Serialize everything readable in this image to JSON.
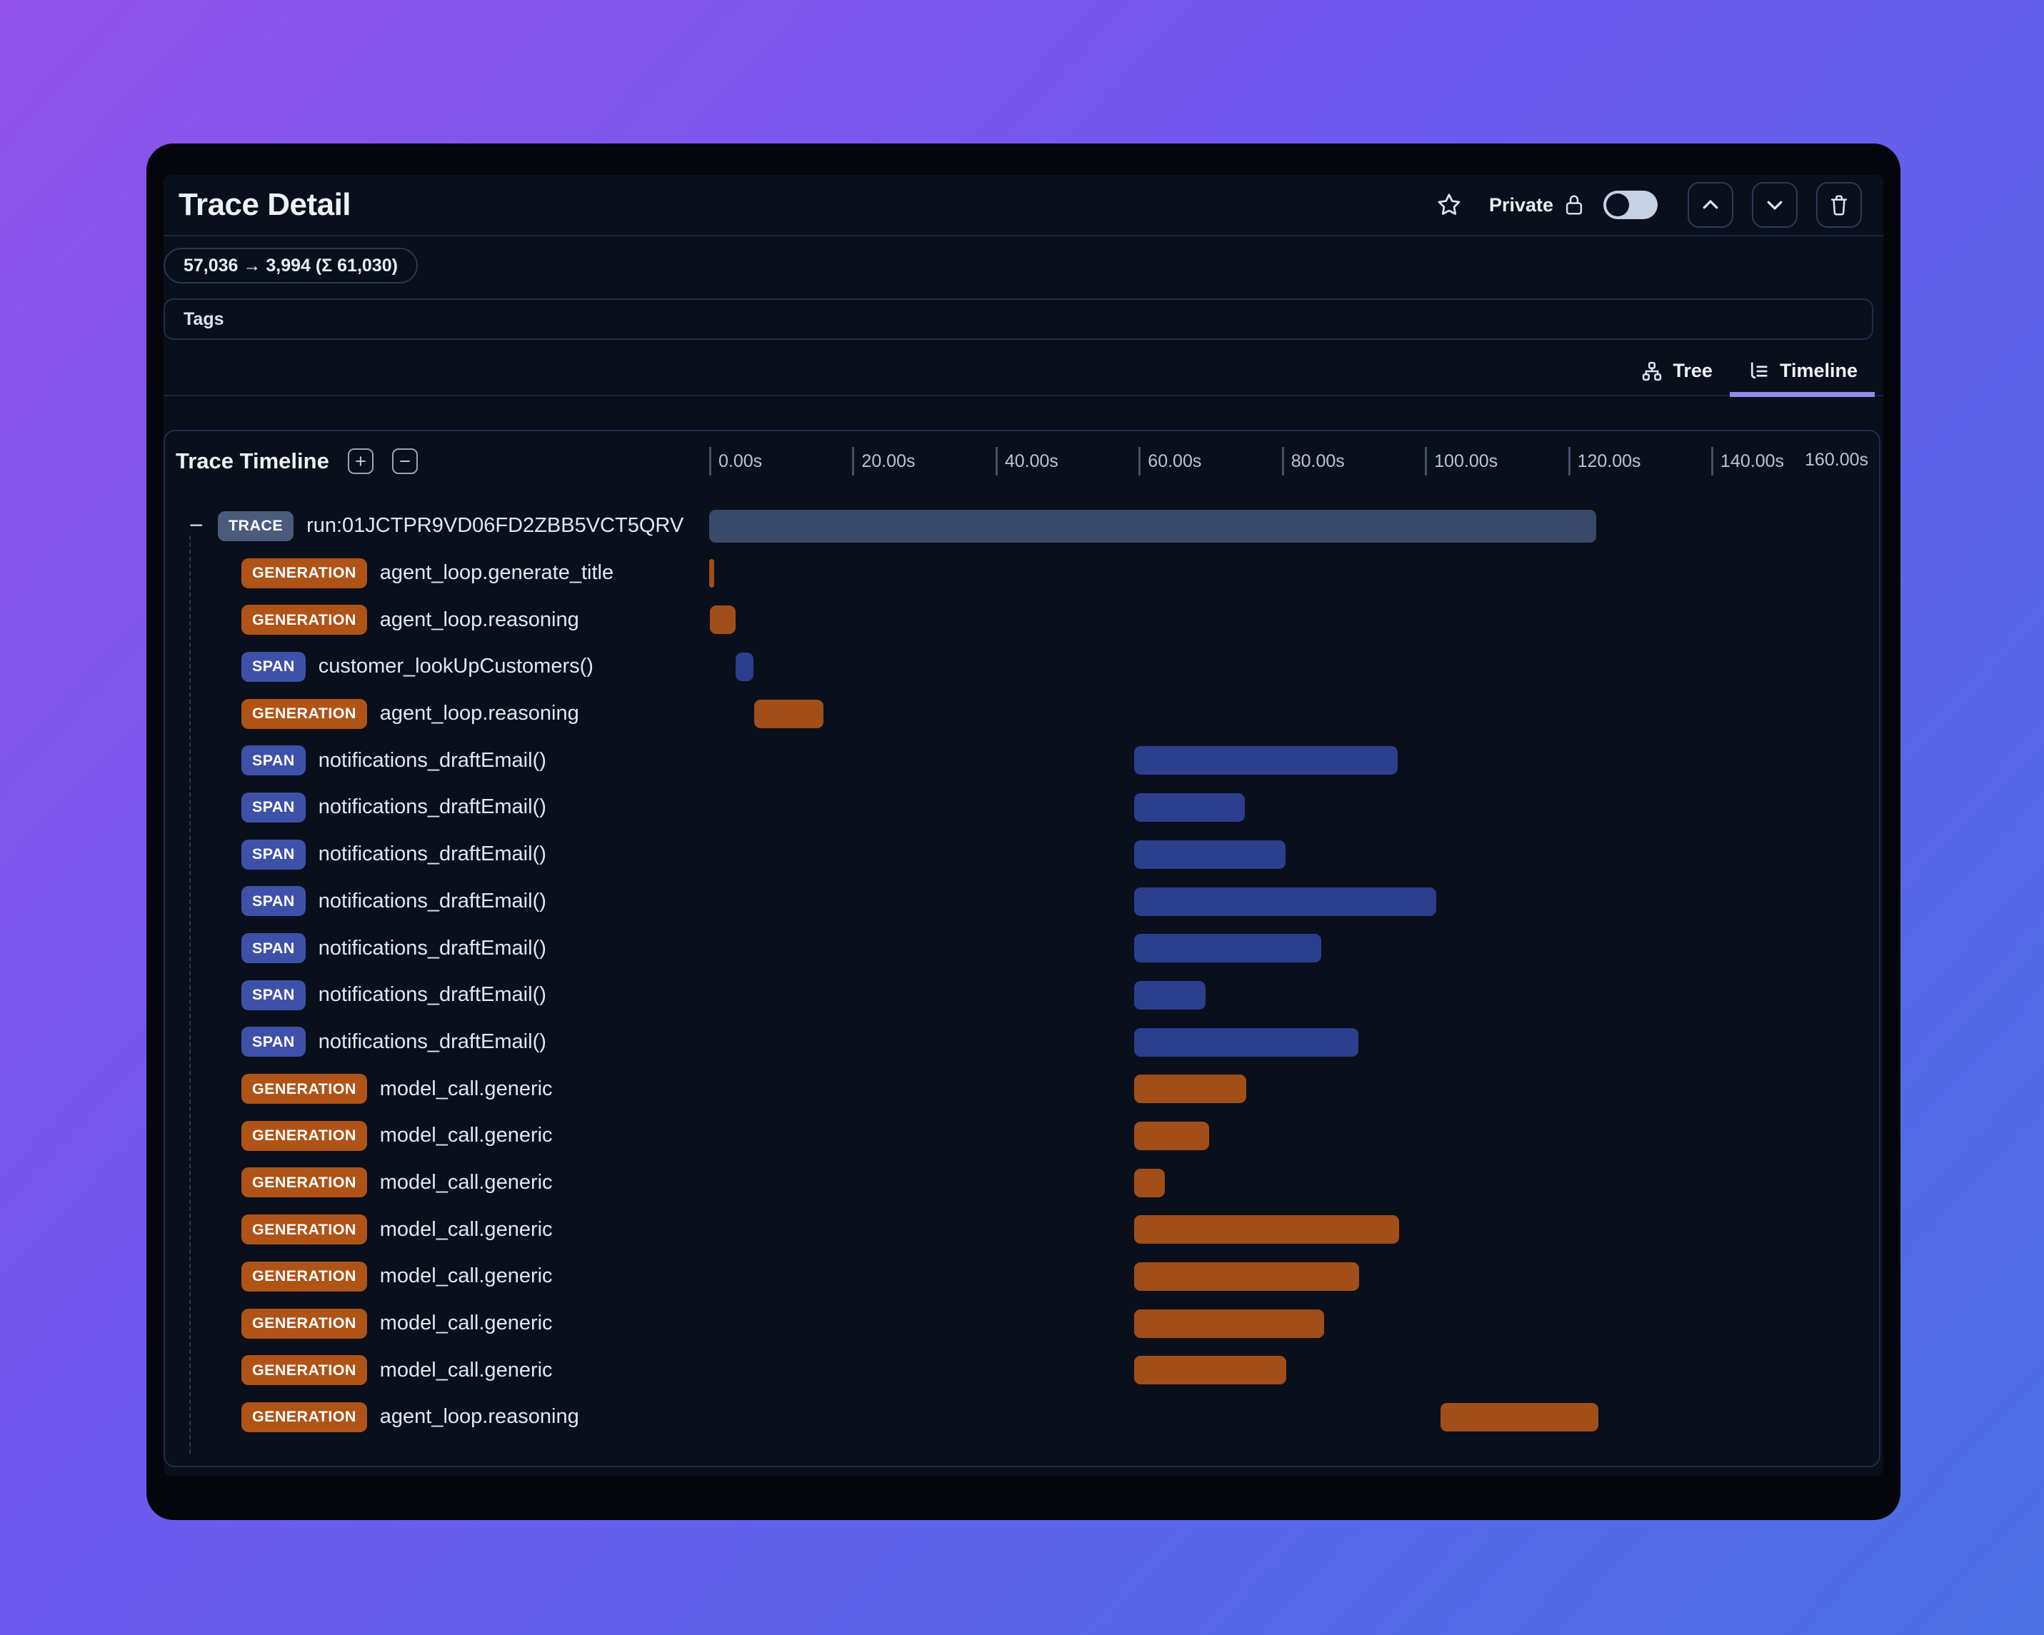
{
  "window": {
    "title": "Trace Detail"
  },
  "header": {
    "privacy_label": "Private",
    "privacy_toggle_state": "off"
  },
  "token_usage": "57,036 → 3,994 (Σ 61,030)",
  "tags_label": "Tags",
  "view_tabs": [
    {
      "label": "Tree",
      "icon": "tree-icon",
      "active": false
    },
    {
      "label": "Timeline",
      "icon": "timeline-icon",
      "active": true
    }
  ],
  "timeline": {
    "title": "Trace Timeline",
    "axis": {
      "unit": "seconds",
      "ticks": [
        {
          "value": 0,
          "label": "0.00s"
        },
        {
          "value": 20,
          "label": "20.00s"
        },
        {
          "value": 40,
          "label": "40.00s"
        },
        {
          "value": 60,
          "label": "60.00s"
        },
        {
          "value": 80,
          "label": "80.00s"
        },
        {
          "value": 100,
          "label": "100.00s"
        },
        {
          "value": 120,
          "label": "120.00s"
        },
        {
          "value": 140,
          "label": "140.00s"
        },
        {
          "value": 160,
          "label": "160.00s",
          "edge": true
        }
      ]
    },
    "rows": [
      {
        "type": "TRACE",
        "label": "run:01JCTPR9VD06FD2ZBB5VCT5QRV",
        "start_s": 0,
        "end_s": 123.9,
        "collapsible": true
      },
      {
        "type": "GENERATION",
        "label": "agent_loop.generate_title",
        "start_s": 0,
        "end_s": 0.7
      },
      {
        "type": "GENERATION",
        "label": "agent_loop.reasoning",
        "start_s": 0.1,
        "end_s": 3.7
      },
      {
        "type": "SPAN",
        "label": "customer_lookUpCustomers()",
        "start_s": 3.7,
        "end_s": 6.2
      },
      {
        "type": "GENERATION",
        "label": "agent_loop.reasoning",
        "start_s": 6.3,
        "end_s": 16.0
      },
      {
        "type": "SPAN",
        "label": "notifications_draftEmail()",
        "start_s": 59.4,
        "end_s": 96.2
      },
      {
        "type": "SPAN",
        "label": "notifications_draftEmail()",
        "start_s": 59.4,
        "end_s": 74.8
      },
      {
        "type": "SPAN",
        "label": "notifications_draftEmail()",
        "start_s": 59.4,
        "end_s": 80.5
      },
      {
        "type": "SPAN",
        "label": "notifications_draftEmail()",
        "start_s": 59.4,
        "end_s": 101.6
      },
      {
        "type": "SPAN",
        "label": "notifications_draftEmail()",
        "start_s": 59.4,
        "end_s": 85.5
      },
      {
        "type": "SPAN",
        "label": "notifications_draftEmail()",
        "start_s": 59.4,
        "end_s": 69.4
      },
      {
        "type": "SPAN",
        "label": "notifications_draftEmail()",
        "start_s": 59.4,
        "end_s": 90.7
      },
      {
        "type": "GENERATION",
        "label": "model_call.generic",
        "start_s": 59.4,
        "end_s": 75.0
      },
      {
        "type": "GENERATION",
        "label": "model_call.generic",
        "start_s": 59.4,
        "end_s": 69.8
      },
      {
        "type": "GENERATION",
        "label": "model_call.generic",
        "start_s": 59.4,
        "end_s": 63.7
      },
      {
        "type": "GENERATION",
        "label": "model_call.generic",
        "start_s": 59.4,
        "end_s": 96.4
      },
      {
        "type": "GENERATION",
        "label": "model_call.generic",
        "start_s": 59.4,
        "end_s": 90.8
      },
      {
        "type": "GENERATION",
        "label": "model_call.generic",
        "start_s": 59.4,
        "end_s": 85.9
      },
      {
        "type": "GENERATION",
        "label": "model_call.generic",
        "start_s": 59.4,
        "end_s": 80.6
      },
      {
        "type": "GENERATION",
        "label": "agent_loop.reasoning",
        "start_s": 102.2,
        "end_s": 124.2
      }
    ]
  },
  "colors": {
    "background_gradient_start": "#8e52ea",
    "background_gradient_end": "#4a70e4",
    "window_frame": "#04060c",
    "content_background": "#0a0f1c",
    "trace_badge": "#4a5b7c",
    "trace_bar": "#394a68",
    "generation_badge": "#b05317",
    "generation_bar": "#a14e18",
    "span_badge": "#3e51a9",
    "span_bar": "#2c3e8e",
    "active_tab_underline": "#9289f0"
  }
}
